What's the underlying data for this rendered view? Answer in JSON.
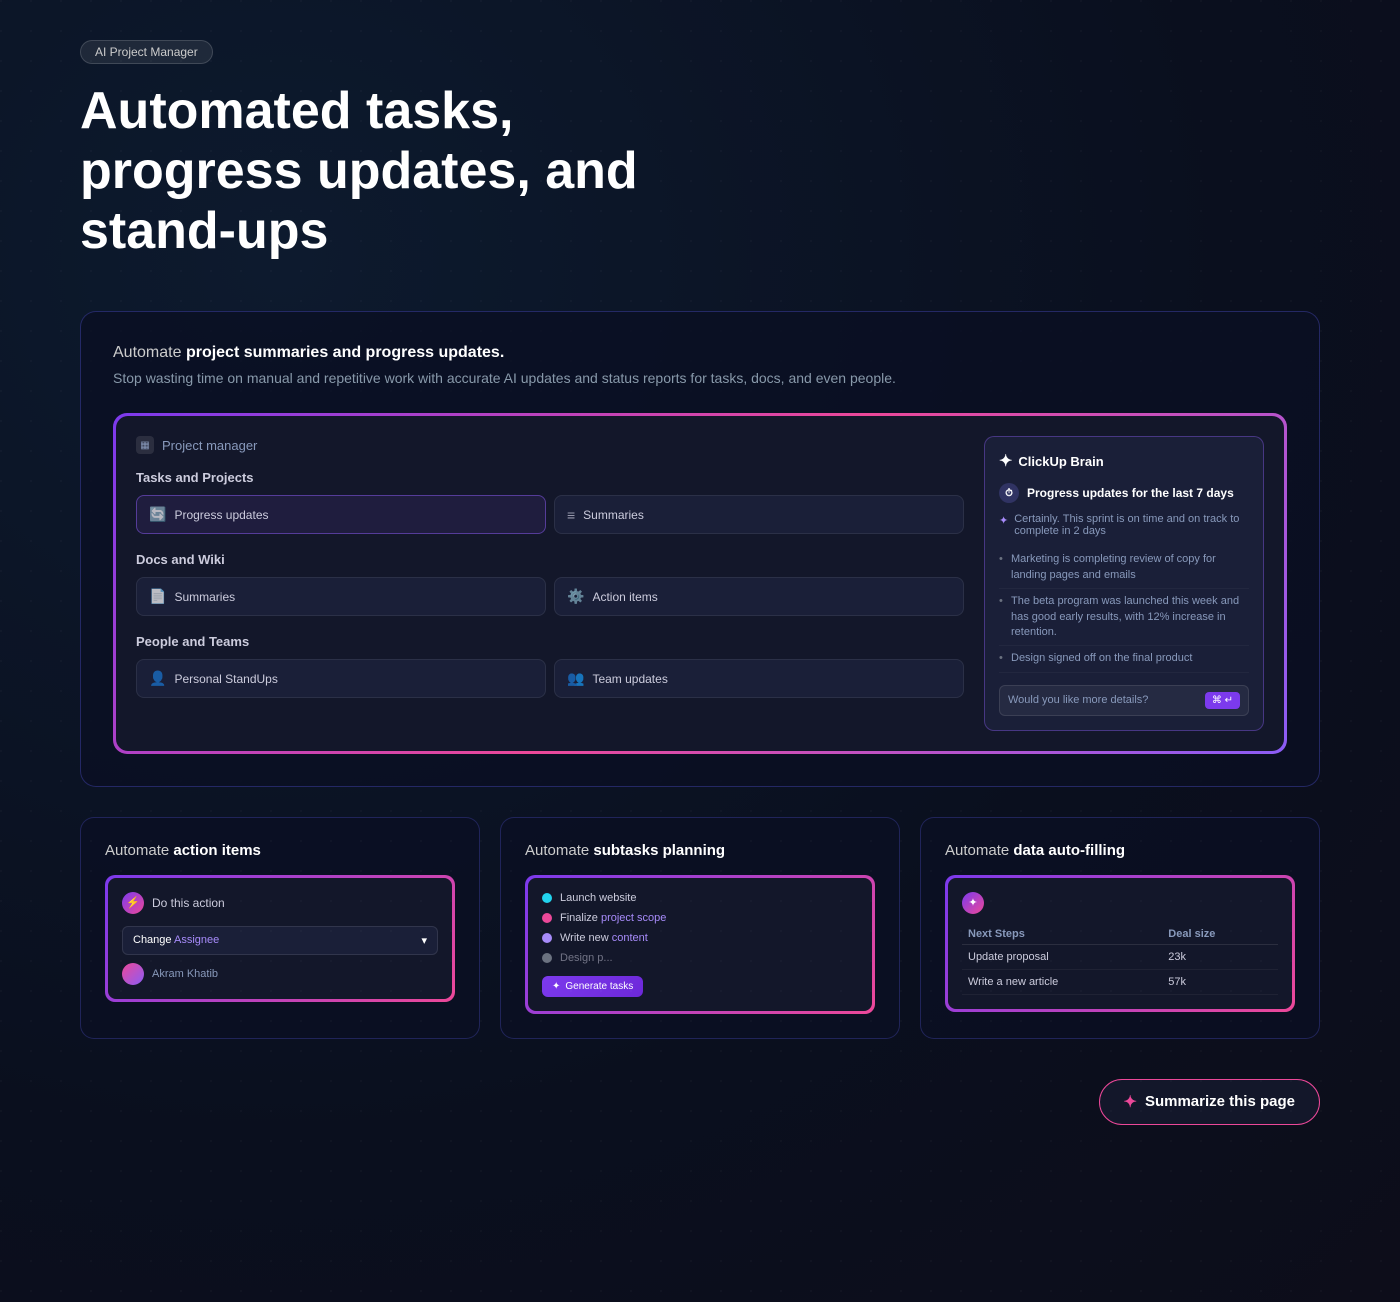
{
  "badge": {
    "label": "AI Project Manager"
  },
  "hero": {
    "title": "Automated tasks, progress updates, and stand-ups"
  },
  "main_card": {
    "intro_bold": "project summaries and progress updates.",
    "intro_prefix": "Automate ",
    "subtitle": "Stop wasting time on manual and repetitive work with accurate AI updates and status reports for tasks, docs, and even people.",
    "app_header": "Project manager",
    "tasks_section": "Tasks and Projects",
    "tasks": [
      {
        "label": "Progress updates",
        "icon": "🔄",
        "active": true
      },
      {
        "label": "Summaries",
        "icon": "≡",
        "active": false
      }
    ],
    "docs_section": "Docs and Wiki",
    "docs": [
      {
        "label": "Summaries",
        "icon": "📄",
        "active": false
      },
      {
        "label": "Action items",
        "icon": "⚙️",
        "active": false
      }
    ],
    "people_section": "People and Teams",
    "people": [
      {
        "label": "Personal StandUps",
        "icon": "👤",
        "active": false
      },
      {
        "label": "Team updates",
        "icon": "👥",
        "active": false
      }
    ],
    "brain": {
      "logo": "✦",
      "title": "ClickUp Brain",
      "query": "Progress updates for the last 7 days",
      "intro": "Certainly. This sprint is on time and on track to complete in 2 days",
      "bullets": [
        "Marketing is completing review of copy for landing pages and emails",
        "The beta program was launched this week and has good early results, with 12% increase in retention.",
        "Design signed off on the final product"
      ],
      "input_placeholder": "Would you like more details?",
      "send_label": "⌘ ↵"
    }
  },
  "bottom_cards": [
    {
      "id": "action-items",
      "title_prefix": "Automate ",
      "title_bold": "action items",
      "action_label": "Do this action",
      "change_label": "Change",
      "field_label": "Assignee",
      "user_name": "Akram Khatib"
    },
    {
      "id": "subtasks",
      "title_prefix": "Automate ",
      "title_bold": "subtasks planning",
      "subtasks": [
        {
          "label": "Launch website",
          "color": "#22d3ee",
          "strike": false
        },
        {
          "label": "Finalize ",
          "highlight": "project scope",
          "color": "#ec4899",
          "strike": false
        },
        {
          "label": "Write new ",
          "highlight": "content",
          "color": "#a78bfa",
          "strike": false
        },
        {
          "label": "Design p...",
          "color": "#6b7280",
          "strike": true
        }
      ],
      "generate_label": "Generate tasks"
    },
    {
      "id": "data-autofill",
      "title_prefix": "Automate ",
      "title_bold": "data auto-filling",
      "table": {
        "headers": [
          "Next Steps",
          "Deal size"
        ],
        "rows": [
          {
            "step": "Update ",
            "step_highlight": "proposal",
            "value": "23k"
          },
          {
            "step": "Write a ",
            "step_highlight": "new article",
            "value": "57k"
          }
        ]
      }
    }
  ],
  "summarize": {
    "label": "Summarize this page",
    "icon": "✦"
  }
}
